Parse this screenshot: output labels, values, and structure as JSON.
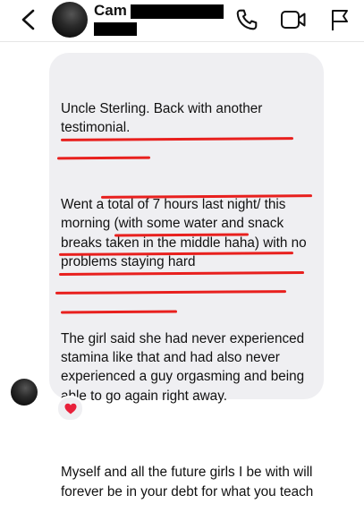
{
  "header": {
    "contact_name": "Cam",
    "back_icon": "chevron-left-icon",
    "actions": [
      "phone-icon",
      "video-camera-icon",
      "flag-icon"
    ]
  },
  "message": {
    "paragraphs": [
      "Uncle Sterling. Back with another testimonial.",
      "Went a total of 7 hours last night/ this morning (with some water and snack breaks taken in the middle haha) with no problems staying hard",
      "The girl said she had never experienced stamina like that and had also never experienced a guy orgasming and being able to go again right away.",
      "Myself and all the future girls I be with will forever be in your debt for what you teach"
    ],
    "reaction": "red-heart-icon"
  },
  "colors": {
    "bubble": "#efeff2",
    "underline": "#e8201e",
    "heart": "#e8213b",
    "redaction": "#000000"
  }
}
